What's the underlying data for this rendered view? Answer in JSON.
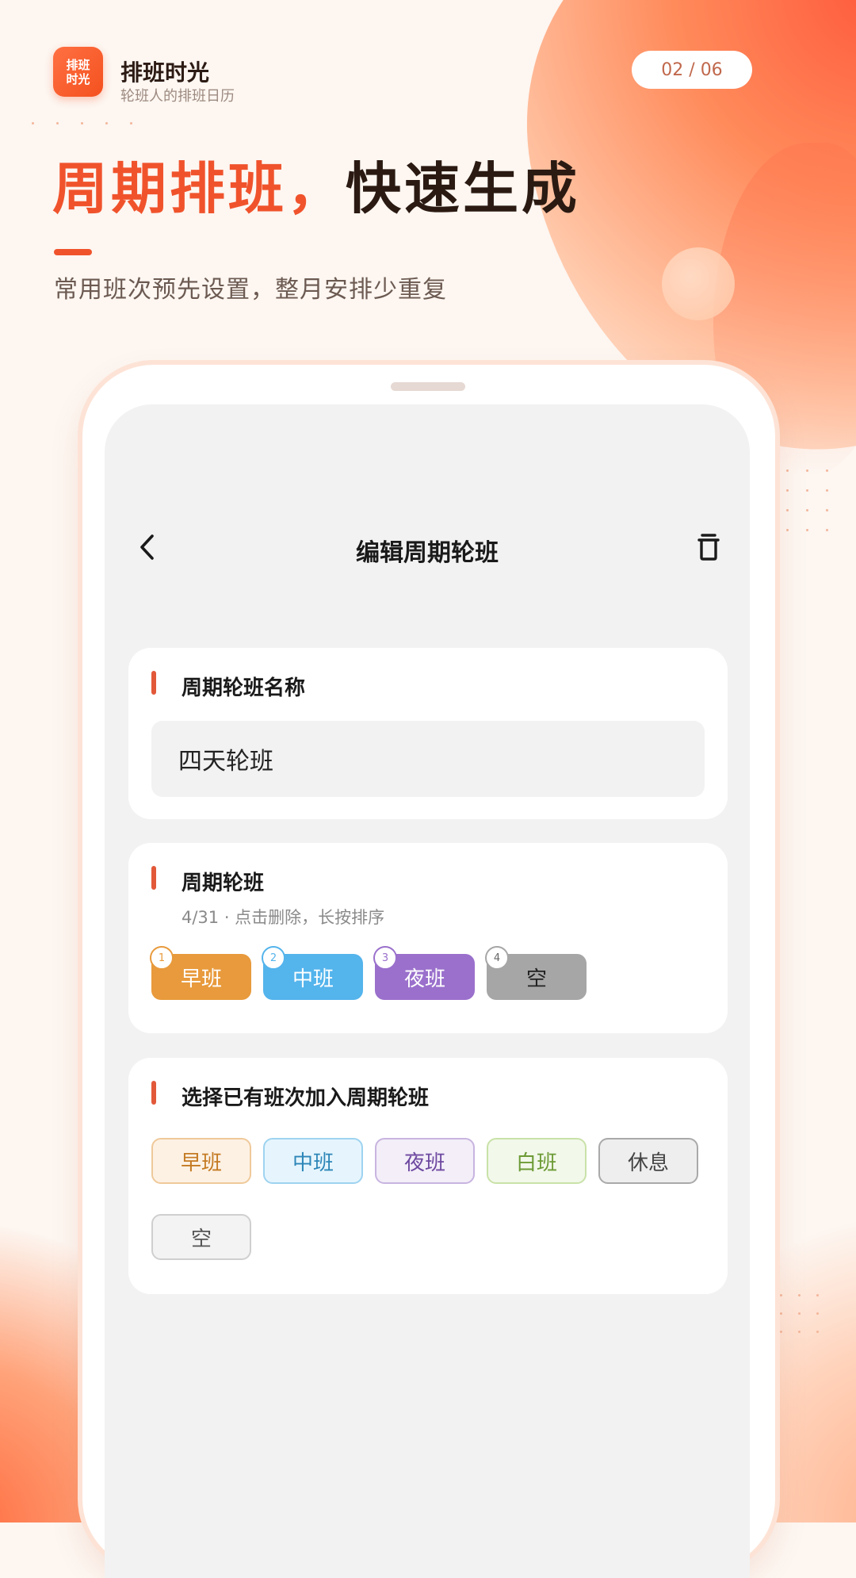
{
  "brand": {
    "logo_line1": "排班",
    "logo_line2": "时光",
    "name": "排班时光",
    "tagline": "轮班人的排班日历"
  },
  "pager": "02 / 06",
  "headline": {
    "accent": "周期排班，",
    "rest": "快速生成"
  },
  "subline": "常用班次预先设置，整月安排少重复",
  "screen": {
    "nav": {
      "back_icon": "chevron-left-icon",
      "title": "编辑周期轮班",
      "trash_icon": "trash-icon"
    },
    "name_card": {
      "title": "周期轮班名称",
      "input_value": "四天轮班"
    },
    "cycle_card": {
      "title": "周期轮班",
      "hint": "4/31 · 点击删除，长按排序",
      "items": [
        {
          "index": "1",
          "label": "早班",
          "color": "#e89a3c",
          "text_color": "#ffffff"
        },
        {
          "index": "2",
          "label": "中班",
          "color": "#54b4ec",
          "text_color": "#ffffff"
        },
        {
          "index": "3",
          "label": "夜班",
          "color": "#9a70cc",
          "text_color": "#ffffff"
        },
        {
          "index": "4",
          "label": "空",
          "color": "#a6a6a6",
          "text_color": "#222222"
        }
      ]
    },
    "pick_card": {
      "title": "选择已有班次加入周期轮班",
      "options": [
        {
          "label": "早班",
          "bg": "#fdf1e4",
          "border": "#efc99a",
          "text": "#c47a22"
        },
        {
          "label": "中班",
          "bg": "#e6f5fd",
          "border": "#9ed3f0",
          "text": "#2d86b8"
        },
        {
          "label": "夜班",
          "bg": "#f3eef8",
          "border": "#c8b4e0",
          "text": "#6d48a0"
        },
        {
          "label": "白班",
          "bg": "#f2f8ea",
          "border": "#c9e2a8",
          "text": "#6c9a34"
        },
        {
          "label": "休息",
          "bg": "#eeeeee",
          "border": "#a9a9a9",
          "text": "#444444"
        },
        {
          "label": "空",
          "bg": "#f3f3f3",
          "border": "#cfcfcf",
          "text": "#555555"
        }
      ]
    }
  }
}
